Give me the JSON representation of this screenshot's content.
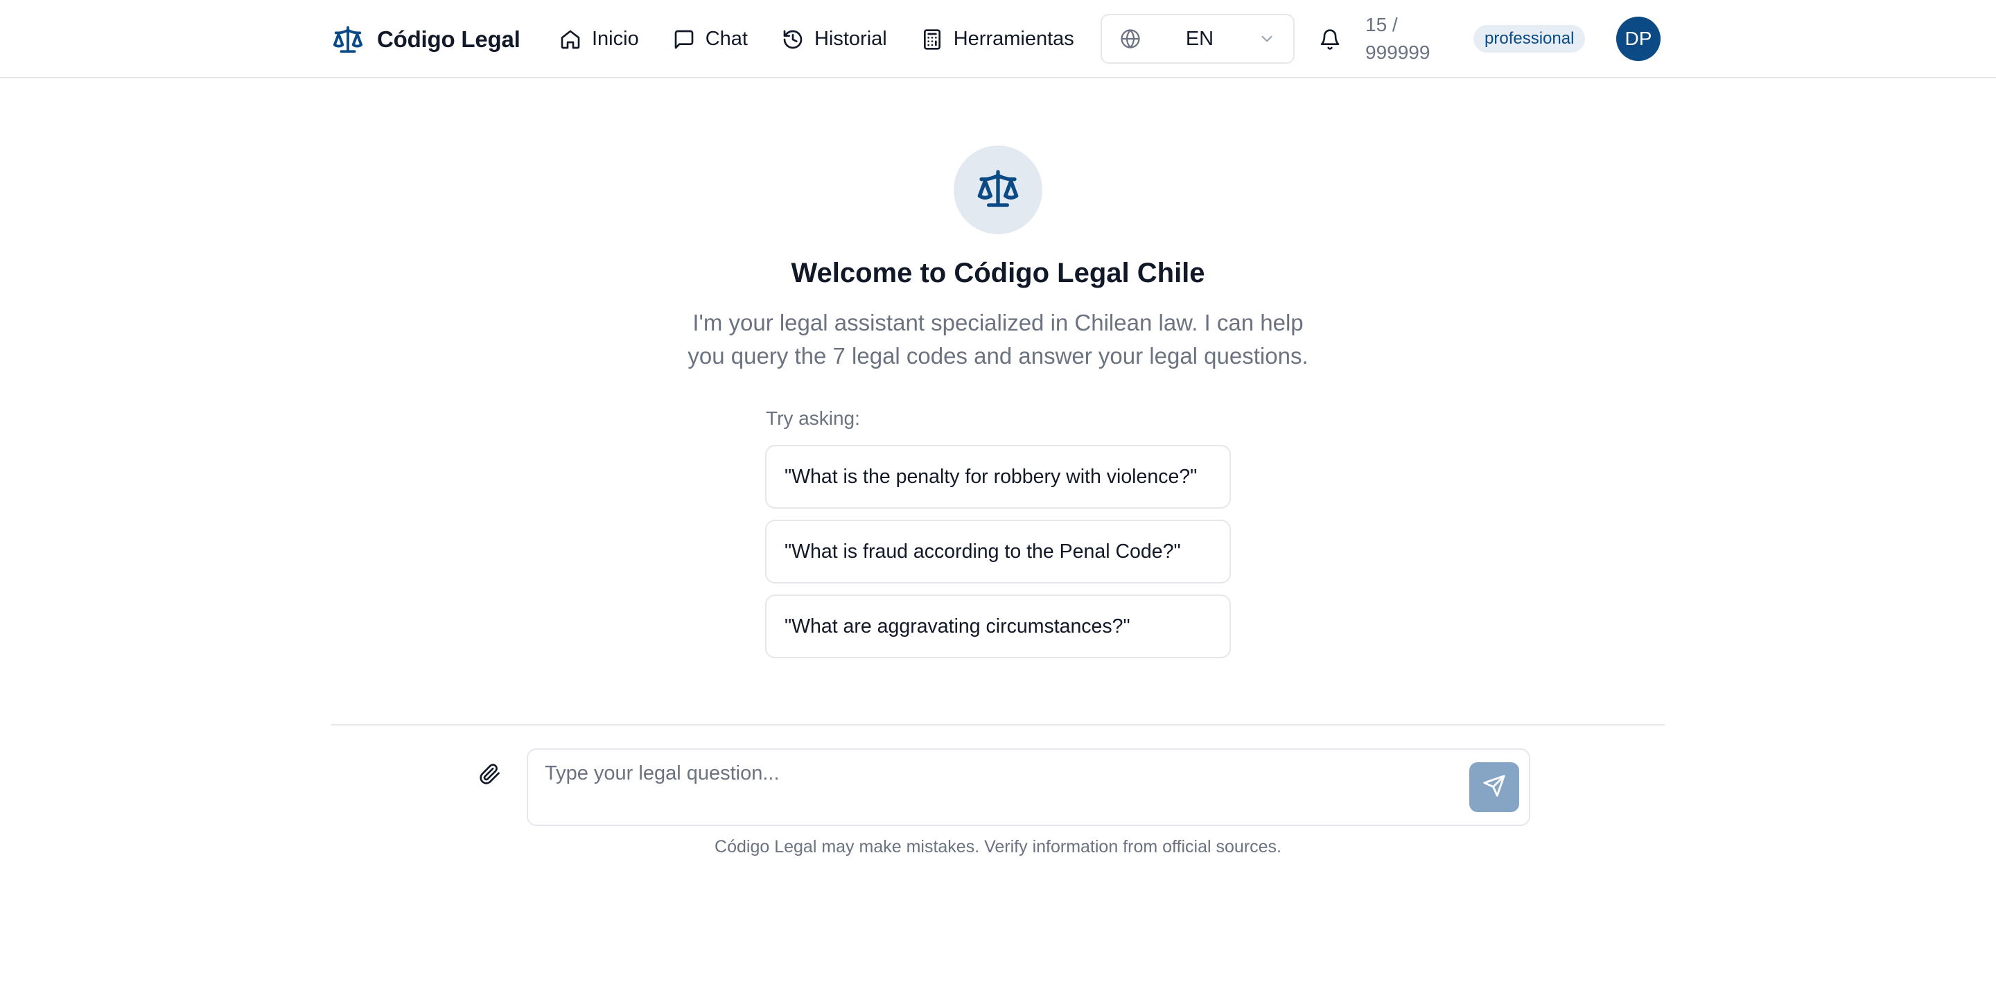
{
  "header": {
    "brand_name": "Código Legal",
    "nav": [
      {
        "label": "Inicio",
        "icon": "home-icon"
      },
      {
        "label": "Chat",
        "icon": "message-square-icon"
      },
      {
        "label": "Historial",
        "icon": "history-icon"
      },
      {
        "label": "Herramientas",
        "icon": "calculator-icon"
      }
    ],
    "language": {
      "value": "EN",
      "icon": "globe-icon"
    },
    "usage": {
      "line1": "15 /",
      "line2": "999999"
    },
    "plan_badge": "professional",
    "avatar_initials": "DP"
  },
  "welcome": {
    "title": "Welcome to Código Legal Chile",
    "subtitle": "I'm your legal assistant specialized in Chilean law. I can help you query the 7 legal codes and answer your legal questions.",
    "try_label": "Try asking:",
    "suggestions": [
      "\"What is the penalty for robbery with violence?\"",
      "\"What is fraud according to the Penal Code?\"",
      "\"What are aggravating circumstances?\""
    ]
  },
  "composer": {
    "placeholder": "Type your legal question...",
    "disclaimer": "Código Legal may make mistakes. Verify information from official sources."
  },
  "colors": {
    "brand": "#0b4a85",
    "send_button": "#86a5c4",
    "hero_circle": "#e3e9f0",
    "badge_bg": "#e6edf5"
  }
}
